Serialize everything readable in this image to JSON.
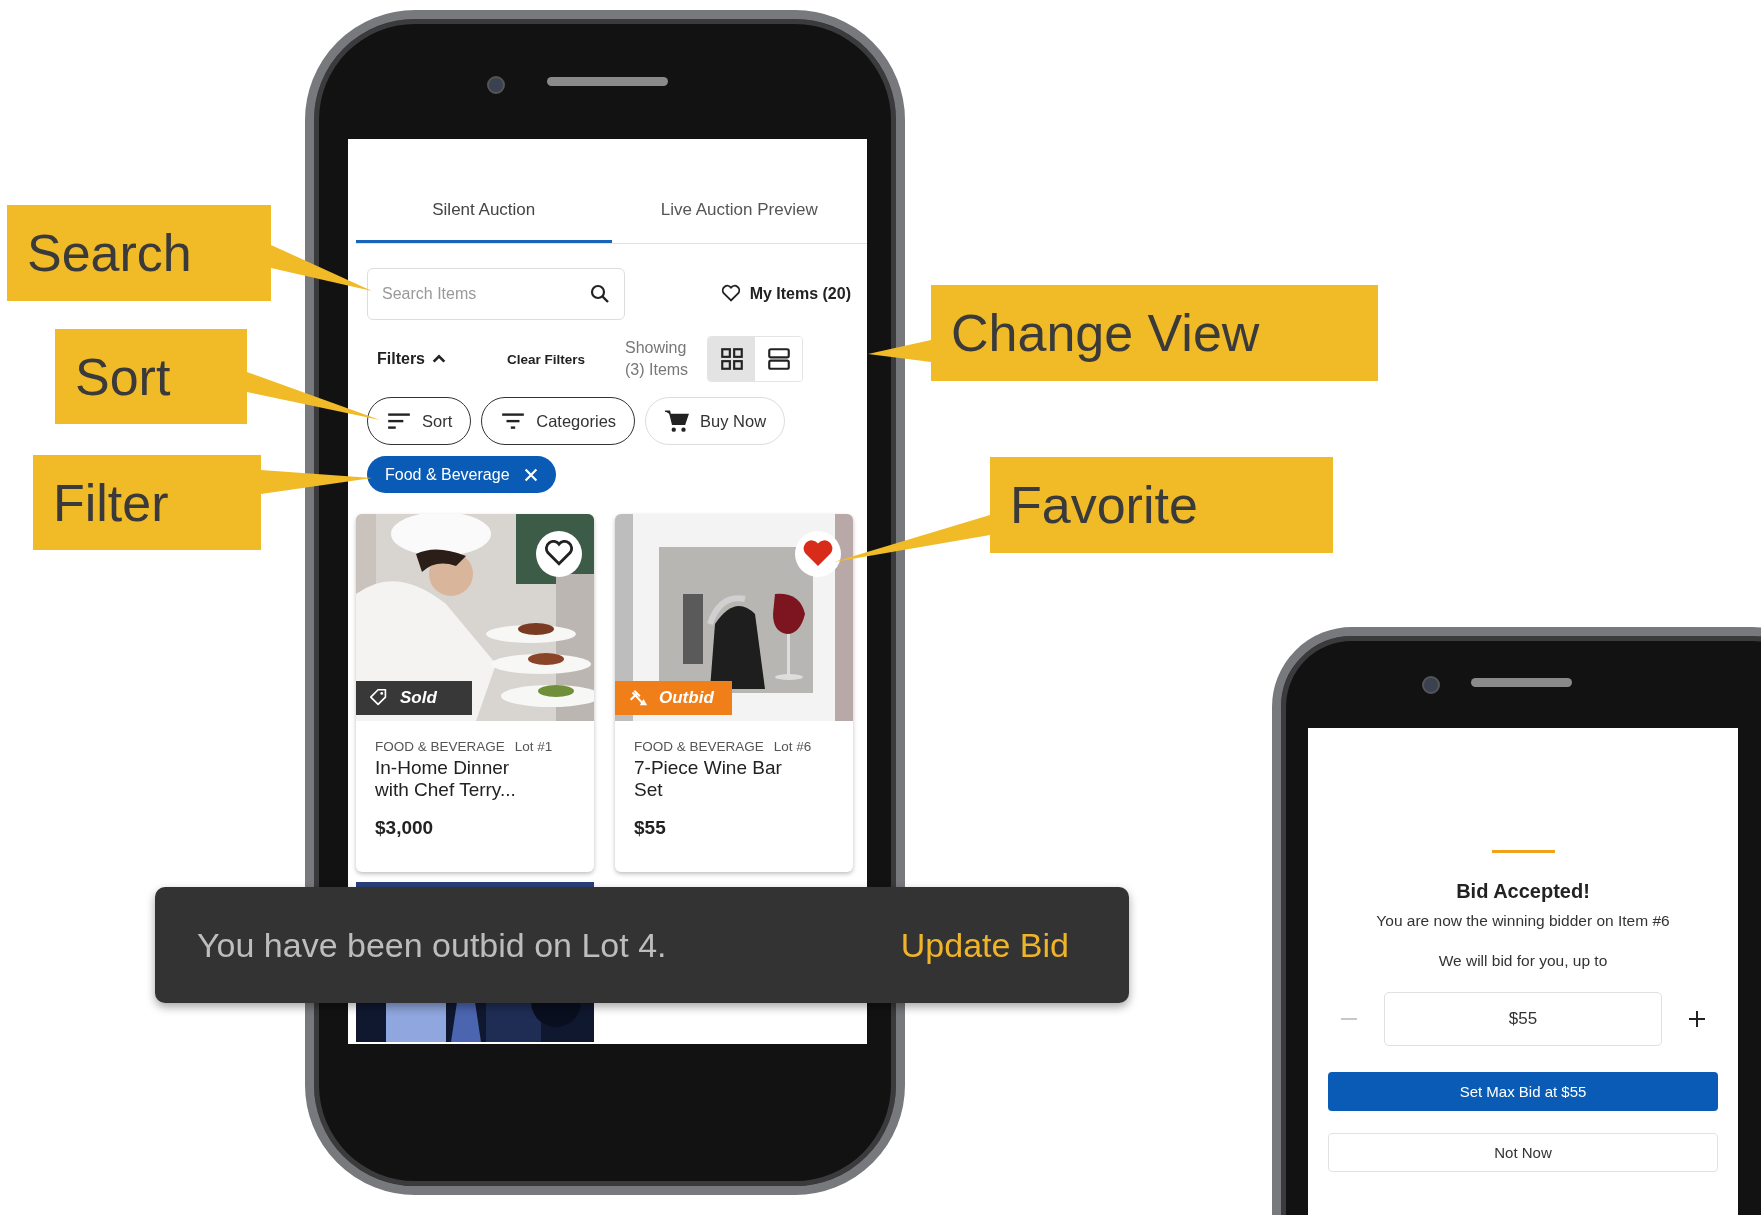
{
  "callouts": [
    {
      "label": "Search"
    },
    {
      "label": "Sort"
    },
    {
      "label": "Filter"
    },
    {
      "label": "Change View"
    },
    {
      "label": "Favorite"
    }
  ],
  "auction_screen": {
    "tabs": [
      {
        "label": "Silent Auction",
        "selected": true
      },
      {
        "label": "Live Auction Preview",
        "selected": false
      }
    ],
    "search": {
      "placeholder": "Search Items"
    },
    "my_items": "My Items (20)",
    "filters": {
      "label": "Filters",
      "expanded": true
    },
    "clear_filters": "Clear Filters",
    "showing": "Showing (3) Items",
    "view_toggle": [
      {
        "kind": "grid",
        "selected": true
      },
      {
        "kind": "list",
        "selected": false
      }
    ],
    "chips": [
      {
        "kind": "sort",
        "label": "Sort",
        "active": true
      },
      {
        "kind": "categories",
        "label": "Categories",
        "active": true
      },
      {
        "kind": "cart",
        "label": "Buy Now",
        "active": false
      }
    ],
    "active_filters": [
      {
        "label": "Food & Beverage"
      }
    ],
    "items": [
      {
        "category": "FOOD & BEVERAGE",
        "lot": "Lot #1",
        "title": "In-Home Dinner with Chef Terry...",
        "price": "$3,000",
        "status": {
          "kind": "sold",
          "label": "Sold"
        },
        "favorite": false
      },
      {
        "category": "FOOD & BEVERAGE",
        "lot": "Lot #6",
        "title": "7-Piece Wine Bar Set",
        "price": "$55",
        "status": {
          "kind": "outbid",
          "label": "Outbid"
        },
        "favorite": true
      }
    ]
  },
  "toast": {
    "message": "You have been outbid on Lot 4.",
    "action": "Update Bid"
  },
  "bid_screen": {
    "title": "Bid Accepted!",
    "message": "You are now the winning bidder on Item #6",
    "prompt": "We will bid for you, up to",
    "amount": "$55",
    "decrease_disabled": true,
    "primary_button": "Set Max Bid at $55",
    "secondary_button": "Not Now"
  }
}
